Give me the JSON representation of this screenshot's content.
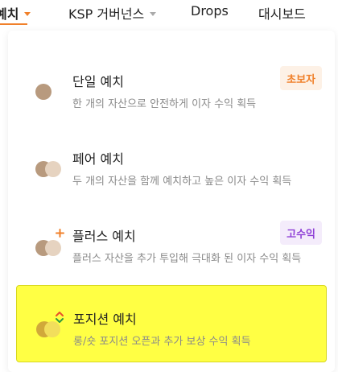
{
  "nav": {
    "items": [
      {
        "label": "예치"
      },
      {
        "label": "KSP 거버넌스"
      },
      {
        "label": "Drops"
      },
      {
        "label": "대시보드"
      }
    ]
  },
  "menu": {
    "items": [
      {
        "title": "단일 예치",
        "desc": "한 개의 자산으로 안전하게 이자 수익 획득",
        "badge": "초보자"
      },
      {
        "title": "페어 예치",
        "desc": "두 개의 자산을 함께 예치하고 높은 이자 수익 획득"
      },
      {
        "title": "플러스 예치",
        "desc": "플러스 자산을 추가 투입해 극대화 된 이자 수익 획득",
        "badge": "고수익"
      },
      {
        "title": "포지션 예치",
        "desc": "롱/숏 포지션 오픈과 추가 보상 수익 획득"
      }
    ]
  },
  "colors": {
    "accent": "#f0802a",
    "highlight": "#ffff44",
    "expert": "#8e3fd6"
  }
}
